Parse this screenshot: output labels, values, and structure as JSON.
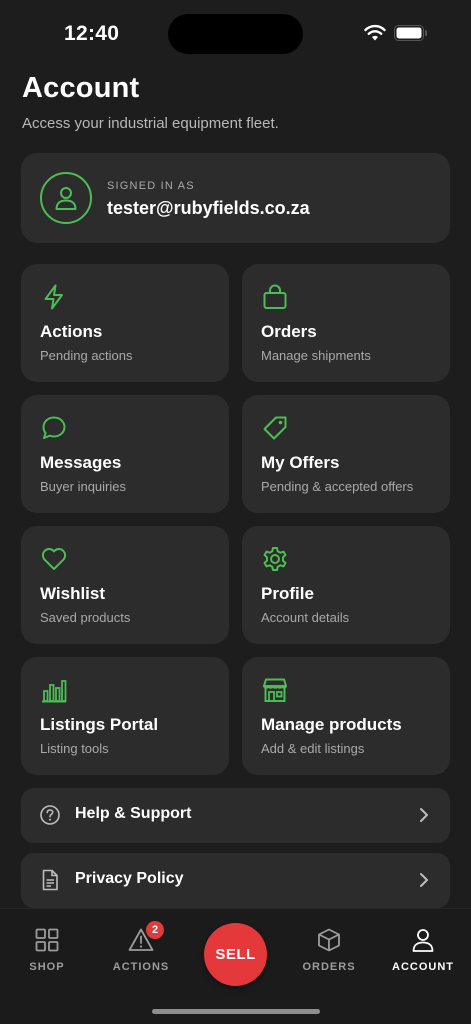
{
  "status_bar": {
    "time": "12:40"
  },
  "header": {
    "title": "Account",
    "subtitle": "Access your industrial equipment fleet."
  },
  "signed_in": {
    "label": "SIGNED IN AS",
    "email": "tester@rubyfields.co.za"
  },
  "tiles": [
    {
      "icon": "lightning-icon",
      "title": "Actions",
      "subtitle": "Pending actions"
    },
    {
      "icon": "shopping-bag-icon",
      "title": "Orders",
      "subtitle": "Manage shipments"
    },
    {
      "icon": "chat-bubble-icon",
      "title": "Messages",
      "subtitle": "Buyer inquiries"
    },
    {
      "icon": "tag-icon",
      "title": "My Offers",
      "subtitle": "Pending & accepted offers"
    },
    {
      "icon": "heart-icon",
      "title": "Wishlist",
      "subtitle": "Saved products"
    },
    {
      "icon": "gear-icon",
      "title": "Profile",
      "subtitle": "Account details"
    },
    {
      "icon": "bar-chart-icon",
      "title": "Listings Portal",
      "subtitle": "Listing tools"
    },
    {
      "icon": "storefront-icon",
      "title": "Manage products",
      "subtitle": "Add & edit listings"
    }
  ],
  "links": [
    {
      "icon": "help-circle-icon",
      "label": "Help & Support"
    },
    {
      "icon": "document-icon",
      "label": "Privacy Policy"
    }
  ],
  "tab_bar": {
    "tabs": [
      {
        "icon": "grid-icon",
        "label": "SHOP"
      },
      {
        "icon": "warning-icon",
        "label": "ACTIONS",
        "badge": "2"
      },
      {
        "icon": "box-icon",
        "label": "ORDERS"
      },
      {
        "icon": "person-icon",
        "label": "ACCOUNT",
        "active": true
      }
    ],
    "sell_label": "SELL"
  },
  "colors": {
    "accent": "#4cbd55",
    "background": "#1d1d1d",
    "card": "#2c2c2c",
    "sell": "#e5383b",
    "badge": "#e03a3a"
  }
}
